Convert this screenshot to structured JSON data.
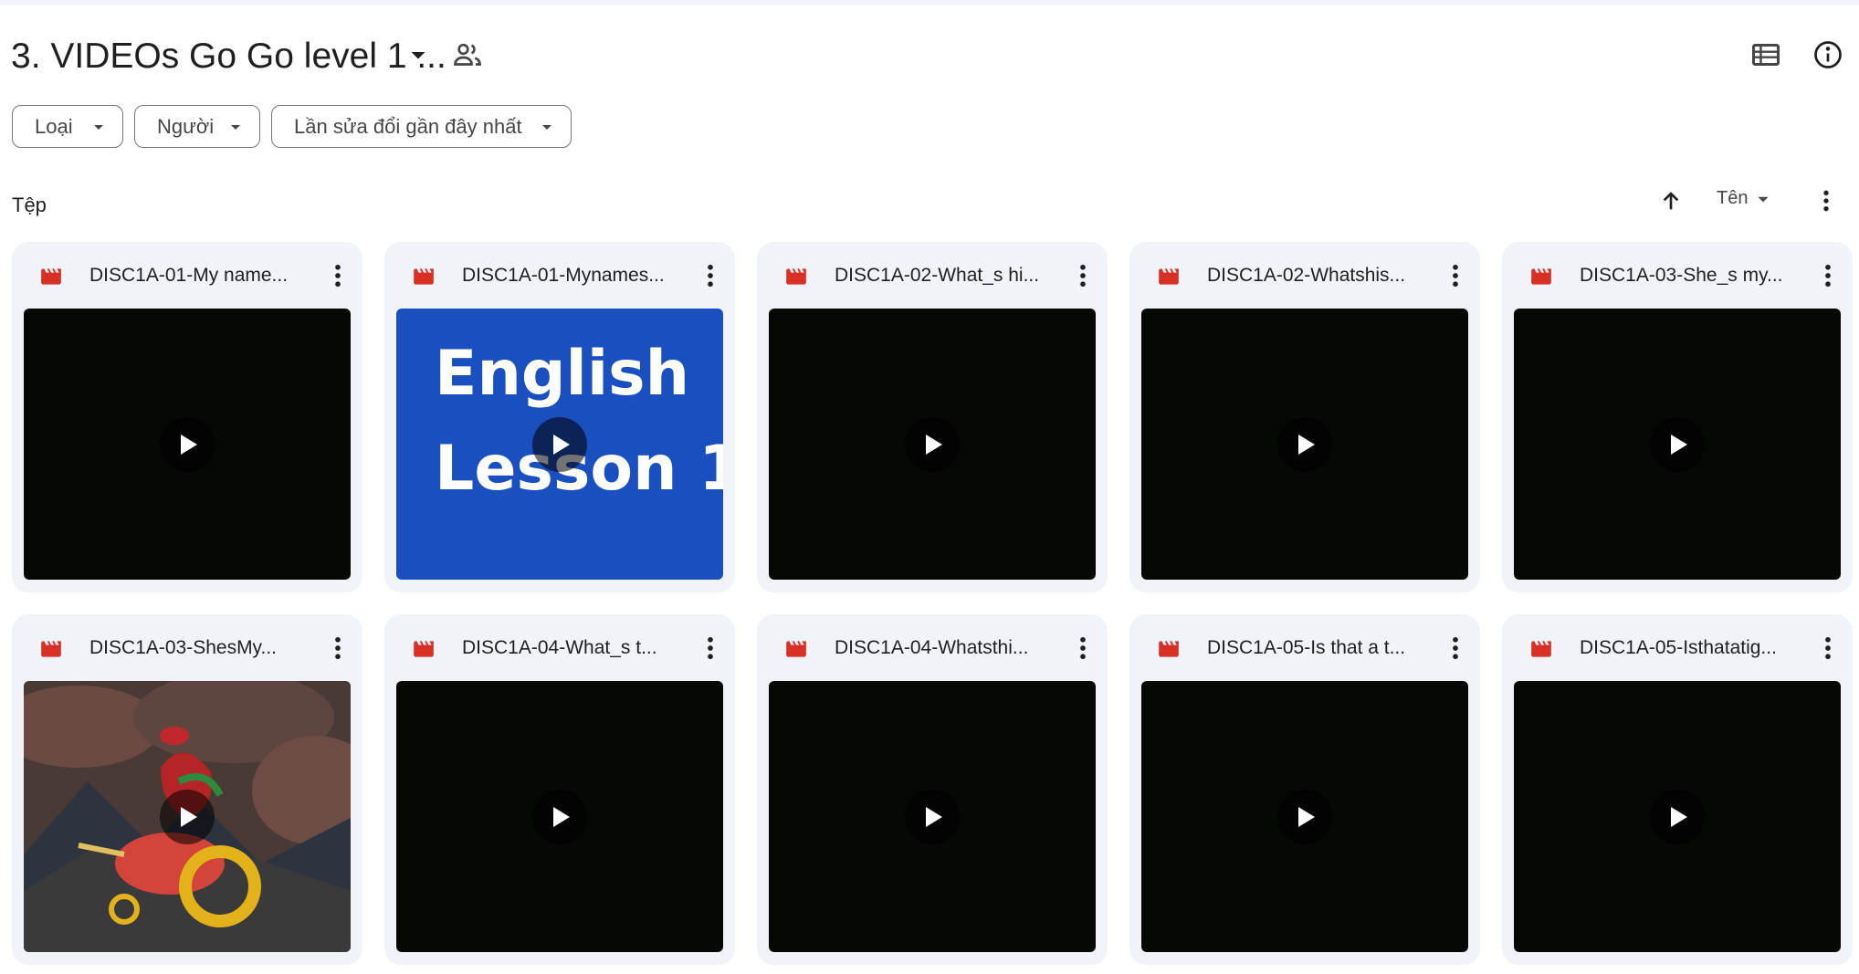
{
  "header": {
    "folder_title": "3. VIDEOs Go Go level 1 ...",
    "title_dropdown_icon": "caret-down-icon",
    "shared_icon": "people-icon",
    "list_view_icon": "list-view-icon",
    "info_icon": "info-icon"
  },
  "filters": [
    {
      "label": "Loại"
    },
    {
      "label": "Người"
    },
    {
      "label": "Lần sửa đổi gần đây nhất"
    }
  ],
  "files_section": {
    "label": "Tệp",
    "sort_direction_icon": "arrow-up-icon",
    "sort_by": "Tên",
    "more_icon": "more-vert-icon"
  },
  "files": [
    {
      "name": "DISC1A-01-My name...",
      "thumbnail": "dark"
    },
    {
      "name": "DISC1A-01-Mynames...",
      "thumbnail": "english-lesson",
      "thumb_text": [
        "English",
        "Lesson 1"
      ]
    },
    {
      "name": "DISC1A-02-What_s hi...",
      "thumbnail": "dark"
    },
    {
      "name": "DISC1A-02-Whatshis...",
      "thumbnail": "dark"
    },
    {
      "name": "DISC1A-03-She_s my...",
      "thumbnail": "dark"
    },
    {
      "name": "DISC1A-03-ShesMy...",
      "thumbnail": "cartoon"
    },
    {
      "name": "DISC1A-04-What_s t...",
      "thumbnail": "dark"
    },
    {
      "name": "DISC1A-04-Whatsthi...",
      "thumbnail": "dark"
    },
    {
      "name": "DISC1A-05-Is that a t...",
      "thumbnail": "dark"
    },
    {
      "name": "DISC1A-05-Isthatatig...",
      "thumbnail": "dark"
    }
  ],
  "colors": {
    "accent_video_icon": "#d93025",
    "card_bg": "#f0f4f9",
    "english_thumb_bg": "#1a4fc0"
  }
}
